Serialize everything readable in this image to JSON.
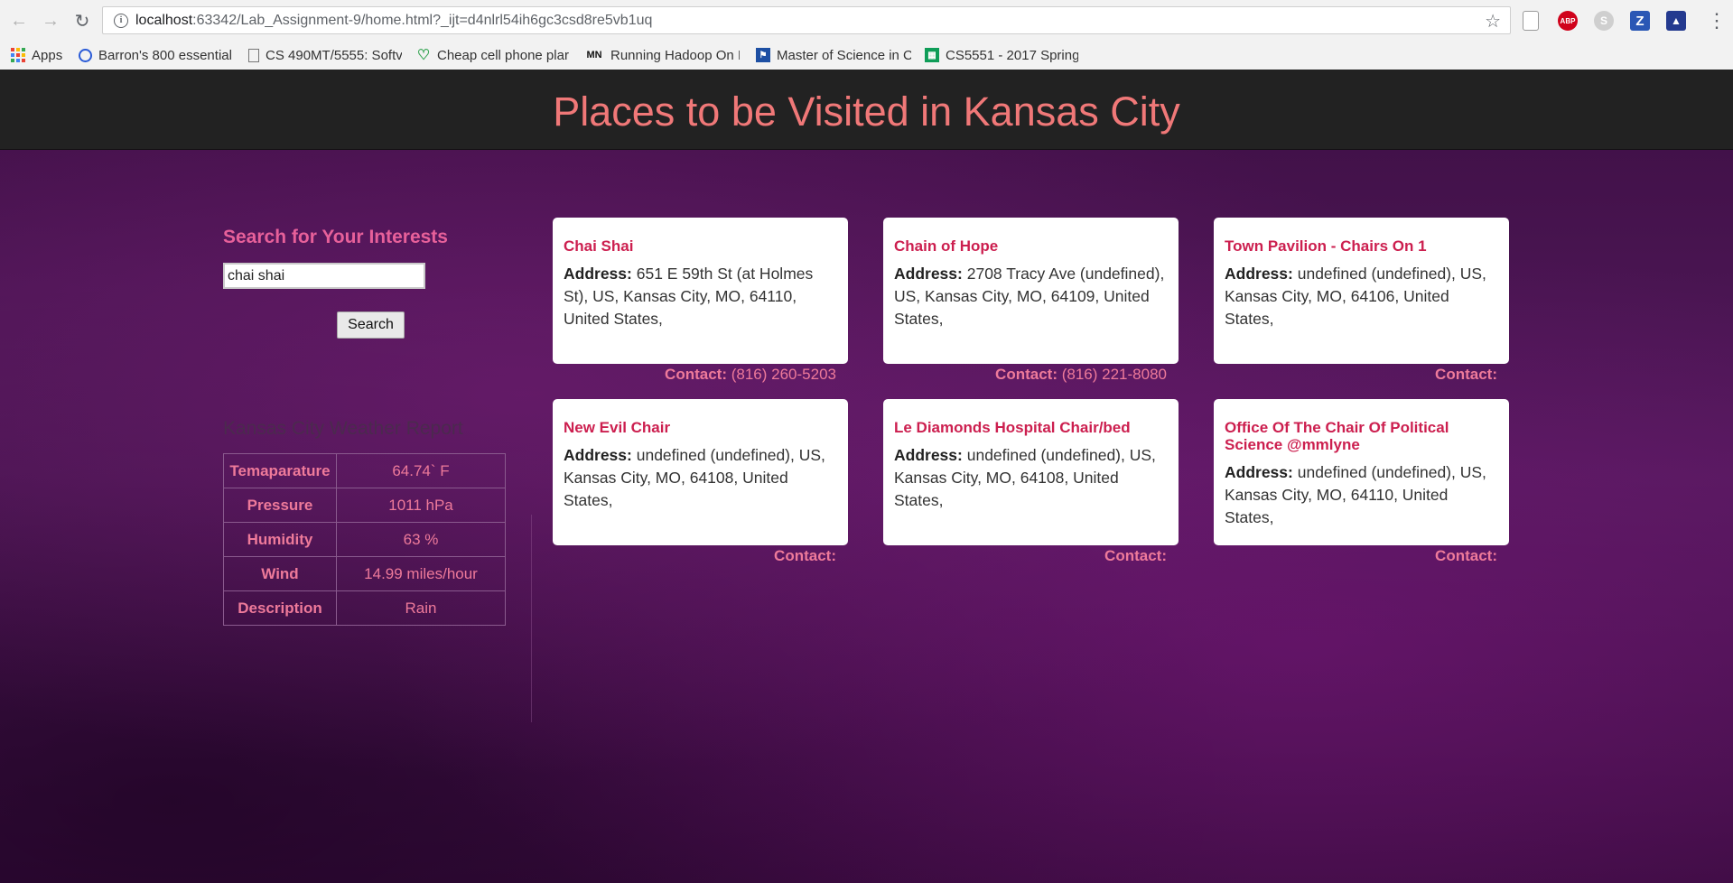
{
  "browser": {
    "url_host": "localhost",
    "url_rest": ":63342/Lab_Assignment-9/home.html?_ijt=d4nlrl54ih6gc3csd8re5vb1uq",
    "bookmarks": [
      {
        "label": "Apps",
        "icon": "apps-grid-icon"
      },
      {
        "label": "Barron's 800 essential",
        "icon": "q-logo-icon"
      },
      {
        "label": "CS 490MT/5555: Softv",
        "icon": "page-icon"
      },
      {
        "label": "Cheap cell phone plar",
        "icon": "heart-leaf-icon"
      },
      {
        "label": "Running Hadoop On I",
        "icon": "mn-icon"
      },
      {
        "label": "Master of Science in C",
        "icon": "umkc-flag-icon"
      },
      {
        "label": "CS5551 - 2017 Spring",
        "icon": "sheets-icon"
      }
    ],
    "extensions": [
      "ABP",
      "S",
      "Z"
    ]
  },
  "header": {
    "title": "Places to be Visited in Kansas City"
  },
  "search": {
    "title": "Search for Your Interests",
    "value": "chai shai",
    "button": "Search"
  },
  "weather": {
    "title": "Kansas City Weather Report",
    "rows": [
      {
        "label": "Temaparature",
        "value": "64.74` F"
      },
      {
        "label": "Pressure",
        "value": "1011 hPa"
      },
      {
        "label": "Humidity",
        "value": "63 %"
      },
      {
        "label": "Wind",
        "value": "14.99 miles/hour"
      },
      {
        "label": "Description",
        "value": "Rain"
      }
    ]
  },
  "labels": {
    "address": "Address:",
    "contact": "Contact:"
  },
  "places": [
    {
      "name": "Chai Shai",
      "address": "651 E 59th St (at Holmes St), US, Kansas City, MO, 64110, United States,",
      "contact": "(816) 260-5203"
    },
    {
      "name": "Chain of Hope",
      "address": "2708 Tracy Ave (undefined), US, Kansas City, MO, 64109, United States,",
      "contact": "(816) 221-8080"
    },
    {
      "name": "Town Pavilion - Chairs On 1",
      "address": "undefined (undefined), US, Kansas City, MO, 64106, United States,",
      "contact": ""
    },
    {
      "name": "New Evil Chair",
      "address": "undefined (undefined), US, Kansas City, MO, 64108, United States,",
      "contact": ""
    },
    {
      "name": "Le Diamonds Hospital Chair/bed",
      "address": "undefined (undefined), US, Kansas City, MO, 64108, United States,",
      "contact": ""
    },
    {
      "name": "Office Of The Chair Of Political Science @mmlyne",
      "address": "undefined (undefined), US, Kansas City, MO, 64110, United States,",
      "contact": ""
    }
  ],
  "colors": {
    "header_title": "#f07878",
    "accent_pink": "#e7609a",
    "place_name": "#cc1f4f",
    "contact": "#ee7a9a",
    "header_bg": "#222222",
    "page_bg": "#4a1550"
  }
}
